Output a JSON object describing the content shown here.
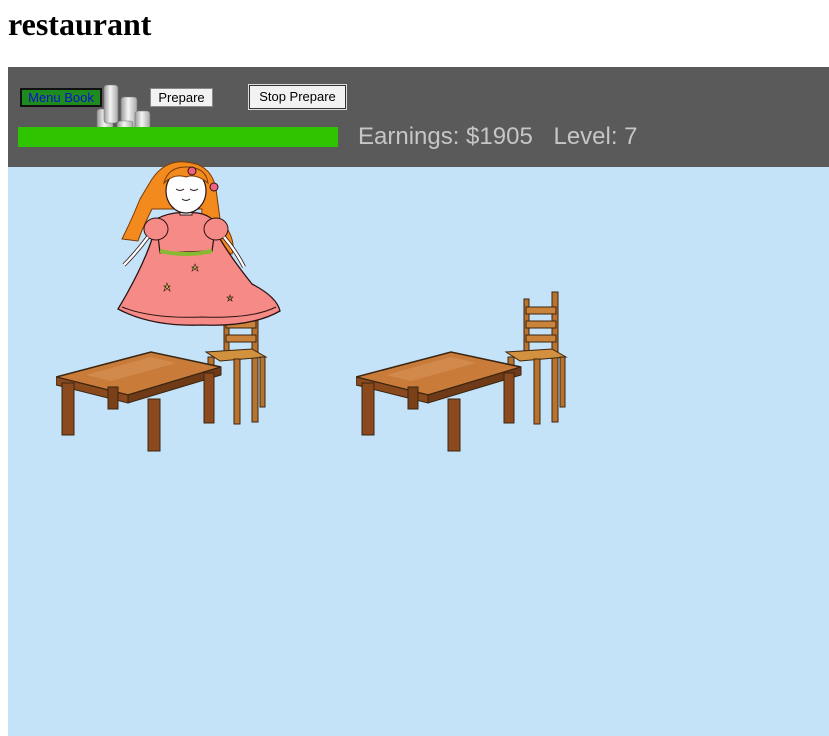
{
  "page": {
    "title": "restaurant"
  },
  "toolbar": {
    "menu_book_label": "Menu Book",
    "prepare_label": "Prepare",
    "stop_prepare_label": "Stop Prepare",
    "earnings_label": "Earnings: $1905",
    "level_label": "Level: 7",
    "progress_fraction": 1.0
  },
  "colors": {
    "toolbar_bg": "#5a5a5a",
    "floor_bg": "#c4e3f8",
    "progress_fill": "#2fc400",
    "menu_book_bg": "#1e8b1e"
  },
  "icons": [
    "milk-cups-icon",
    "waitress-character",
    "table-icon",
    "chair-icon"
  ]
}
